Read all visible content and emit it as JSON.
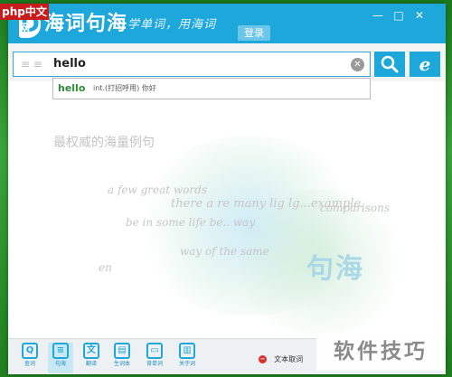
{
  "titlebar": {
    "logo_letter": "D",
    "app_name": "海词句海",
    "slogan": "学单词，用海词",
    "login_label": "登录",
    "minimize": "—",
    "maximize": "□",
    "close": "✕"
  },
  "search": {
    "mode_icon": "≡ ≡",
    "value": "hello",
    "clear_icon": "✕",
    "ie_label": "e"
  },
  "suggestion": {
    "word": "hello",
    "definition": "int.(打招呼用) 你好"
  },
  "content": {
    "headline": "最权威的海量例句",
    "ghost_lines": [
      "a few great words",
      "there a re many lig lg...example",
      "comparisons",
      "be in some life be.. way",
      "way of the same",
      "en"
    ],
    "brand_text": "句海"
  },
  "toolbar": {
    "items": [
      {
        "label": "查词",
        "icon": "search-icon",
        "glyph": "Q"
      },
      {
        "label": "句海",
        "icon": "sentence-icon",
        "glyph": "≡"
      },
      {
        "label": "翻译",
        "icon": "translate-icon",
        "glyph": "文"
      },
      {
        "label": "生词本",
        "icon": "vocab-book-icon",
        "glyph": "▤"
      },
      {
        "label": "背单词",
        "icon": "memorize-icon",
        "glyph": "▭"
      },
      {
        "label": "关于词",
        "icon": "about-icon",
        "glyph": "▥"
      }
    ],
    "active_index": 1,
    "text_pick_label": "文本取词",
    "text_pick_icon": "−"
  },
  "watermarks": {
    "php": "php中文网",
    "tips": "软件技巧"
  },
  "colors": {
    "accent": "#1ea7db",
    "word_green": "#2e8b36",
    "desktop_green": "#2b8a2b"
  }
}
